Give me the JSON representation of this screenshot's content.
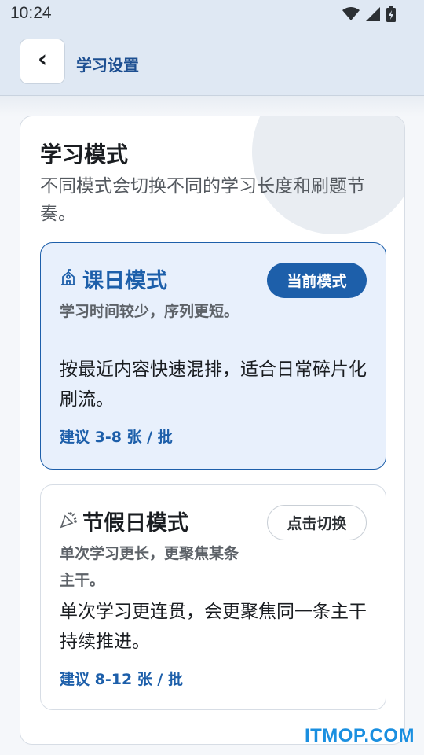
{
  "status_bar": {
    "time": "10:24",
    "icons": [
      "wifi-icon",
      "signal-icon",
      "battery-charging-icon"
    ]
  },
  "header": {
    "back_glyph": "‹",
    "title": "学习设置"
  },
  "section": {
    "title": "学习模式",
    "description": "不同模式会切换不同的学习长度和刷题节奏。"
  },
  "modes": [
    {
      "icon": "school-icon",
      "icon_glyph": "🏫",
      "title": "课日模式",
      "subtitle": "学习时间较少，序列更短。",
      "description": "按最近内容快速混排，适合日常碎片化刷流。",
      "recommendation": "建议 3-8 张 / 批",
      "action_label": "当前模式",
      "selected": true
    },
    {
      "icon": "party-popper-icon",
      "icon_glyph": "🎉",
      "title": "节假日模式",
      "subtitle": "单次学习更长，更聚焦某条主干。",
      "description": "单次学习更连贯，会更聚焦同一条主干持续推进。",
      "recommendation": "建议 8-12 张 / 批",
      "action_label": "点击切换",
      "selected": false
    }
  ],
  "watermark": "ITMOP.COM",
  "colors": {
    "accent": "#1d5faa",
    "header_bg": "#dfe8f3",
    "selected_card_bg": "#e8f0fc"
  }
}
